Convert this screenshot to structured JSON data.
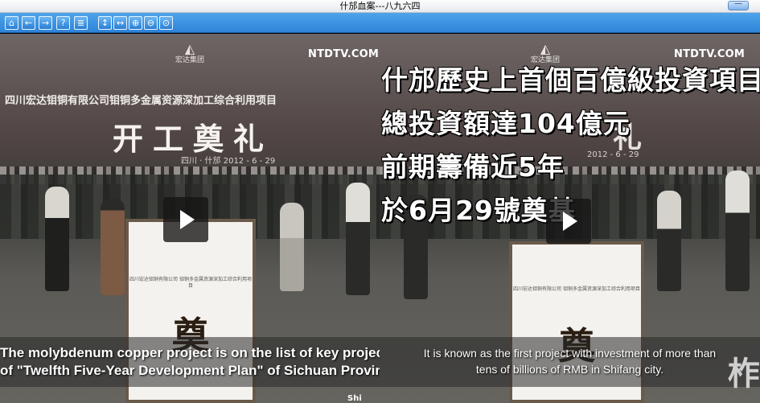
{
  "window": {
    "title": "什邡血案---八九六四",
    "min_label": "—"
  },
  "toolbar": {
    "buttons": [
      {
        "name": "home",
        "glyph": "⌂"
      },
      {
        "name": "back",
        "glyph": "←"
      },
      {
        "name": "forward",
        "glyph": "→"
      },
      {
        "name": "help",
        "glyph": "?"
      },
      {
        "name": "contents",
        "glyph": "≣"
      },
      {
        "name": "fit-height",
        "glyph": "↕"
      },
      {
        "name": "fit-width",
        "glyph": "↔"
      },
      {
        "name": "zoom-in",
        "glyph": "⊕"
      },
      {
        "name": "zoom-out",
        "glyph": "⊖"
      },
      {
        "name": "zoom-reset",
        "glyph": "⊙"
      }
    ]
  },
  "frame1": {
    "watermark": "NTDTV.COM",
    "logo_text": "宏达集团",
    "banner_line1": "四川宏达钼铜有限公司钼铜多金属资源深加工综合利用项目",
    "banner_line2": "开工奠礼",
    "banner_date": "四川 · 什邡     2012 - 6 - 29",
    "board_small": "四川宏达钼铜有限公司 钼铜多金属资源深加工综合利用项目",
    "board_big": "奠",
    "subtitle_line1": "The molybdenum copper project is on the list of key projects",
    "subtitle_line2": "of \"Twelfth Five-Year Development Plan\" of Sichuan Province.",
    "corner": "Shi"
  },
  "frame2": {
    "watermark": "NTDTV.COM",
    "logo_text": "宏达集团",
    "overlay_lines": [
      "什邡歷史上首個百億級投資項目",
      "總投資額達104億元",
      "前期籌備近5年",
      "於6月29號奠基"
    ],
    "banner_date": "2012 - 6 - 29",
    "banner_partial": "礼",
    "board_small": "四川宏达钼铜有限公司 钼铜多金属资源深加工综合利用项目",
    "board_big": "奠",
    "subtitle_line1": "It is known as the first project with investment of more than",
    "subtitle_line2": "tens of billions of RMB in Shifang city.",
    "edge_char": "柞"
  }
}
